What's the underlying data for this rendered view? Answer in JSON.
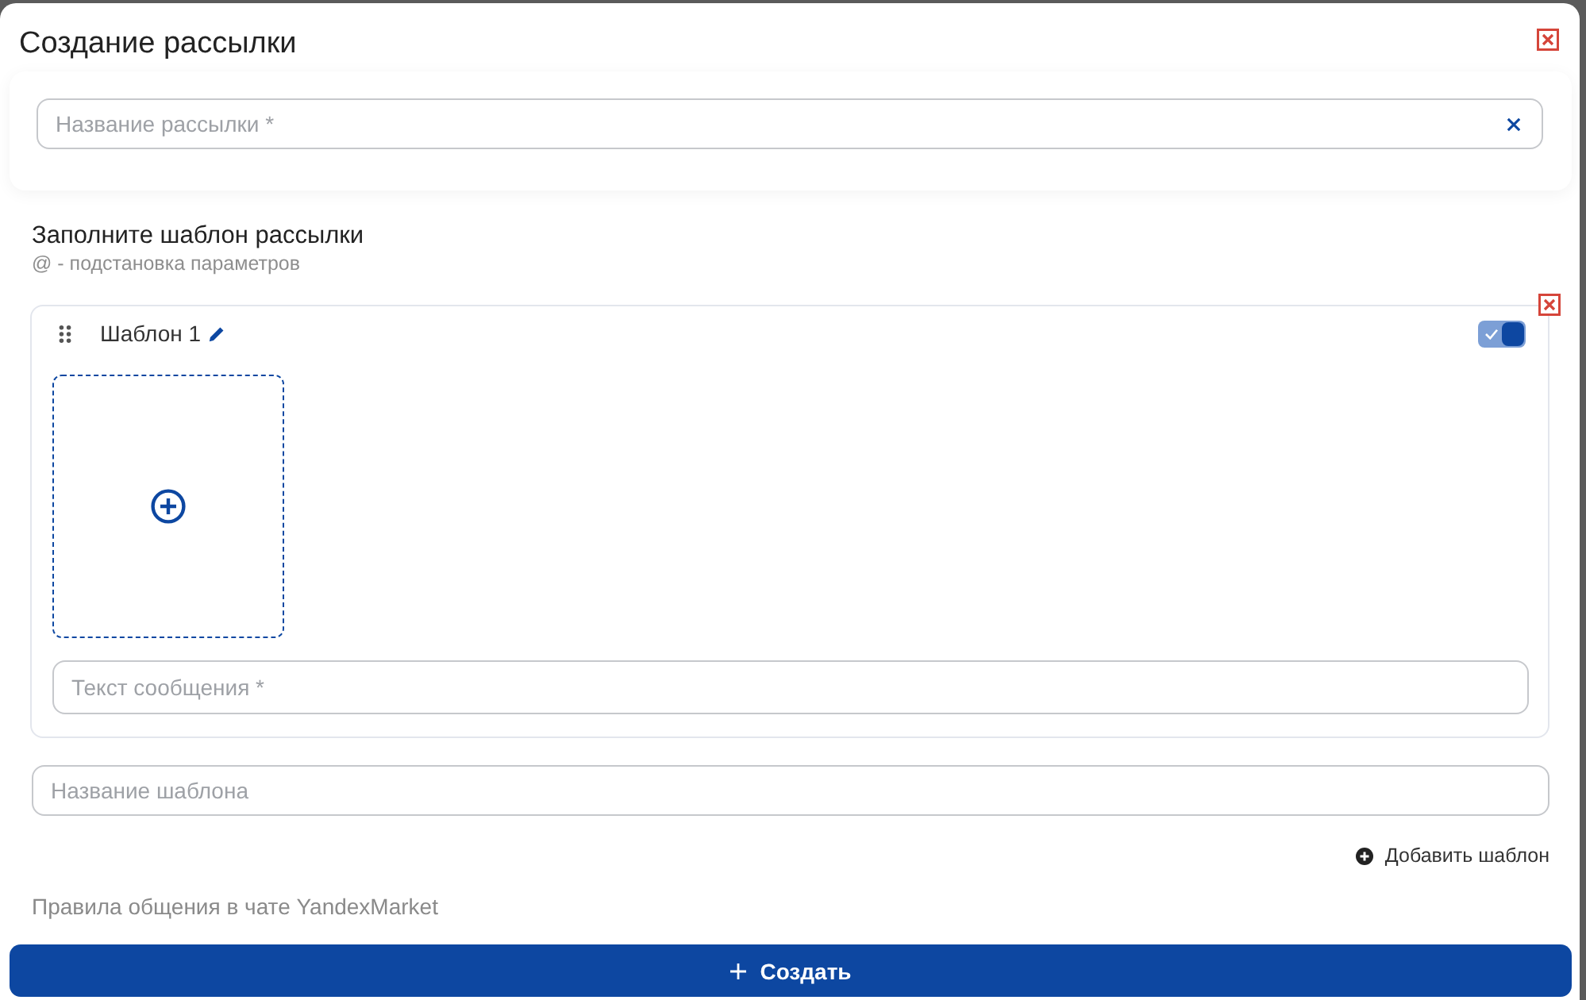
{
  "dialog": {
    "title": "Создание рассылки"
  },
  "mailing_name": {
    "placeholder": "Название рассылки *"
  },
  "template_section": {
    "title": "Заполните шаблон рассылки",
    "hint": "@ - подстановка параметров"
  },
  "templates": [
    {
      "name": "Шаблон 1",
      "enabled": true,
      "message": {
        "placeholder": "Текст сообщения *"
      }
    }
  ],
  "template_name": {
    "placeholder": "Название шаблона"
  },
  "add_template": {
    "label": "Добавить шаблон"
  },
  "rules_text": "Правила общения в чате YandexMarket",
  "create_button": {
    "label": "Создать"
  }
}
